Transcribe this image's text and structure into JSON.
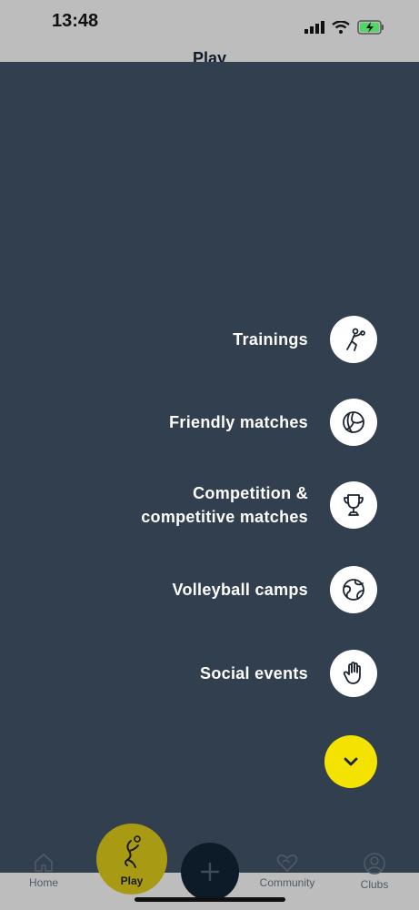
{
  "status_bar": {
    "time": "13:48"
  },
  "page": {
    "title": "Play"
  },
  "menu": {
    "items": [
      {
        "label": "Trainings",
        "icon": "trainer-person-icon"
      },
      {
        "label": "Friendly matches",
        "icon": "volleyball-icon"
      },
      {
        "label": "Competition &\ncompetitive matches",
        "icon": "trophy-icon"
      },
      {
        "label": "Volleyball camps",
        "icon": "globe-ball-icon"
      },
      {
        "label": "Social events",
        "icon": "hand-wave-icon"
      }
    ]
  },
  "tabs": {
    "home": "Home",
    "play": "Play",
    "community": "Community",
    "clubs": "Clubs"
  },
  "colors": {
    "overlay": "#323f4e",
    "accent": "#f4e200",
    "dark": "#0d1a28"
  }
}
